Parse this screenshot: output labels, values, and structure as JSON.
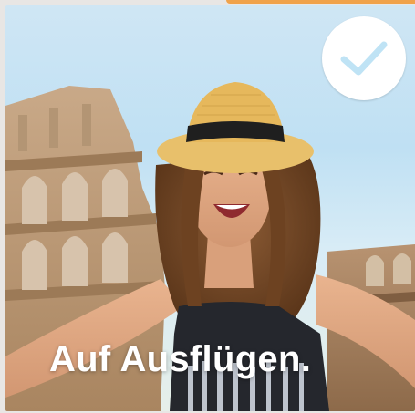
{
  "card": {
    "caption": "Auf Ausflügen.",
    "selected": true,
    "check_icon": "check-icon",
    "accent_color": "#f0a24a",
    "check_color": "#bfe3f5"
  }
}
